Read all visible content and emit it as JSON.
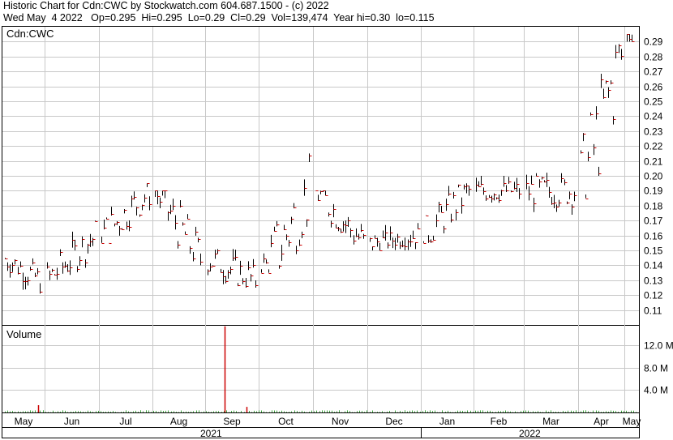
{
  "header": {
    "line1": "Historic Chart for Cdn:CWC by Stockwatch.com 604.687.1500 - (c) 2022",
    "line2": "Wed May  4 2022   Op=0.295  Hi=0.295  Lo=0.29  Cl=0.29  Vol=139,474  Year hi=0.30  lo=0.115"
  },
  "colors": {
    "up": "#cc0000",
    "bar": "#000000",
    "grid": "#c8c8c8",
    "volume_up": "#44aa44",
    "volume_spike": "#cc0000"
  },
  "chart_data": [
    {
      "type": "ohlc",
      "title": "Cdn:CWC",
      "x": [
        "May",
        "Jun",
        "Jul",
        "Aug",
        "Sep",
        "Oct",
        "Nov",
        "Dec",
        "Jan",
        "Feb",
        "Mar",
        "Apr",
        "May"
      ],
      "year_labels": [
        "2021",
        "2022"
      ],
      "y_ticks": [
        0.11,
        0.12,
        0.13,
        0.14,
        0.15,
        0.16,
        0.17,
        0.18,
        0.19,
        0.2,
        0.21,
        0.22,
        0.23,
        0.24,
        0.25,
        0.26,
        0.27,
        0.28,
        0.29
      ],
      "y_tick_labels": [
        "0.11",
        "0.12",
        "0.13",
        "0.14",
        "0.15",
        "0.16",
        "0.17",
        "0.18",
        "0.19",
        "0.20",
        "0.21",
        "0.22",
        "0.23",
        "0.24",
        "0.25",
        "0.26",
        "0.27",
        "0.28",
        "0.29"
      ],
      "ylim": [
        0.1,
        0.3
      ],
      "grid": true,
      "monthly_ohlc": [
        {
          "month": "May 2021",
          "open": 0.145,
          "high": 0.145,
          "low": 0.115,
          "close": 0.13
        },
        {
          "month": "Jun 2021",
          "open": 0.13,
          "high": 0.17,
          "low": 0.13,
          "close": 0.16
        },
        {
          "month": "Jul 2021",
          "open": 0.16,
          "high": 0.195,
          "low": 0.155,
          "close": 0.19
        },
        {
          "month": "Aug 2021",
          "open": 0.19,
          "high": 0.19,
          "low": 0.14,
          "close": 0.145
        },
        {
          "month": "Sep 2021",
          "open": 0.145,
          "high": 0.16,
          "low": 0.125,
          "close": 0.13
        },
        {
          "month": "Oct 2021",
          "open": 0.13,
          "high": 0.215,
          "low": 0.135,
          "close": 0.19
        },
        {
          "month": "Nov 2021",
          "open": 0.19,
          "high": 0.19,
          "low": 0.15,
          "close": 0.155
        },
        {
          "month": "Dec 2021",
          "open": 0.155,
          "high": 0.17,
          "low": 0.15,
          "close": 0.16
        },
        {
          "month": "Jan 2022",
          "open": 0.16,
          "high": 0.195,
          "low": 0.155,
          "close": 0.19
        },
        {
          "month": "Feb 2022",
          "open": 0.19,
          "high": 0.2,
          "low": 0.175,
          "close": 0.19
        },
        {
          "month": "Mar 2022",
          "open": 0.19,
          "high": 0.205,
          "low": 0.17,
          "close": 0.19
        },
        {
          "month": "Apr 2022",
          "open": 0.19,
          "high": 0.3,
          "low": 0.185,
          "close": 0.28
        },
        {
          "month": "May 2022",
          "open": 0.295,
          "high": 0.295,
          "low": 0.29,
          "close": 0.29
        }
      ]
    },
    {
      "type": "bar",
      "title": "Volume",
      "y_ticks": [
        4.0,
        8.0,
        12.0
      ],
      "y_tick_labels": [
        "4.0 M",
        "8.0 M",
        "12.0 M"
      ],
      "ylim": [
        0,
        15.5
      ],
      "grid": true,
      "notable": [
        {
          "x": "May 2021",
          "value": 1.3
        },
        {
          "x": "Aug 2021",
          "value": 15.4
        },
        {
          "x": "Sep 2021",
          "value": 1.0
        }
      ]
    }
  ]
}
